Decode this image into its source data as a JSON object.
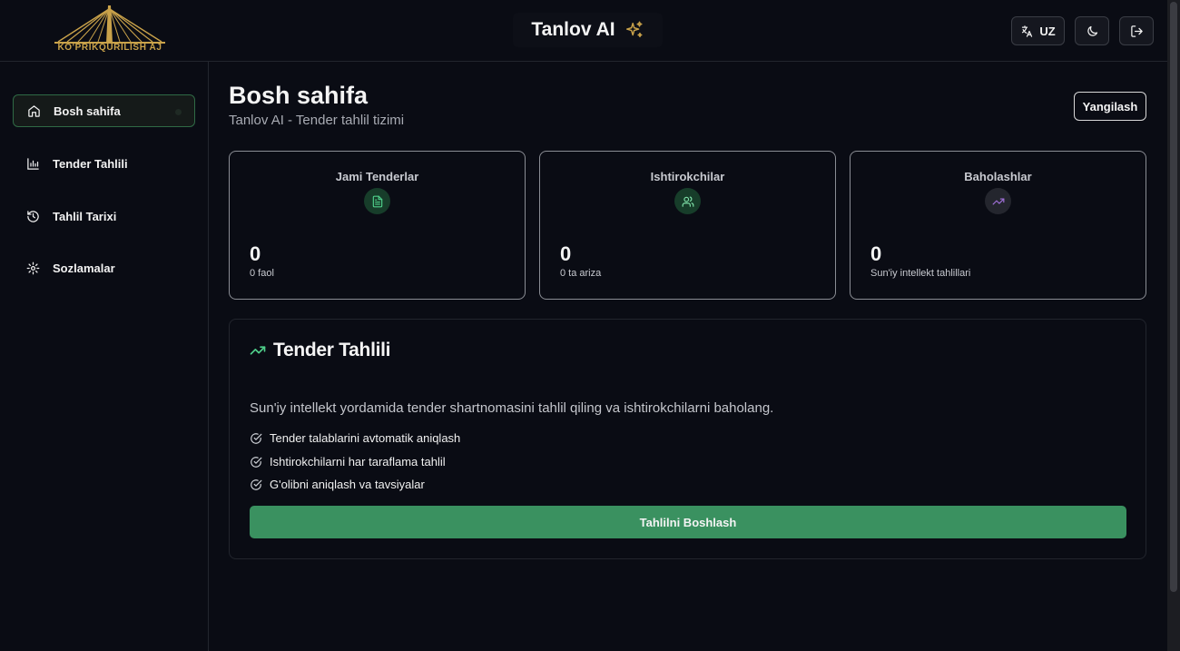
{
  "header": {
    "logo_text": "KO'PRIKQURILISH AJ",
    "app_title": "Tanlov AI",
    "language_label": "UZ"
  },
  "sidebar": {
    "items": [
      {
        "label": "Bosh sahifa",
        "icon": "home-icon",
        "active": true
      },
      {
        "label": "Tender Tahlili",
        "icon": "bar-chart-icon",
        "active": false
      },
      {
        "label": "Tahlil Tarixi",
        "icon": "history-icon",
        "active": false
      },
      {
        "label": "Sozlamalar",
        "icon": "gear-icon",
        "active": false
      }
    ]
  },
  "main": {
    "title": "Bosh sahifa",
    "subtitle": "Tanlov AI - Tender tahlil tizimi",
    "refresh_label": "Yangilash",
    "stats": [
      {
        "title": "Jami Tenderlar",
        "value": "0",
        "sub": "0 faol",
        "icon": "document-icon",
        "icon_color": "#4fcf8a",
        "icon_bg": "#173d2a"
      },
      {
        "title": "Ishtirokchilar",
        "value": "0",
        "sub": "0 ta ariza",
        "icon": "users-icon",
        "icon_color": "#7fe0a8",
        "icon_bg": "#173d2a"
      },
      {
        "title": "Baholashlar",
        "value": "0",
        "sub": "Sun'iy intellekt tahlillari",
        "icon": "trending-up-icon",
        "icon_color": "#a070d8",
        "icon_bg": "#24262e"
      }
    ],
    "analysis": {
      "title": "Tender Tahlili",
      "description": "Sun'iy intellekt yordamida tender shartnomasini tahlil qiling va ishtirokchilarni baholang.",
      "features": [
        "Tender talablarini avtomatik aniqlash",
        "Ishtirokchilarni har taraflama tahlil",
        "G'olibni aniqlash va tavsiyalar"
      ],
      "start_label": "Tahlilni Boshlash"
    }
  },
  "colors": {
    "background": "#0a0c14",
    "accent": "#3a9160",
    "gold": "#c9a24a"
  }
}
